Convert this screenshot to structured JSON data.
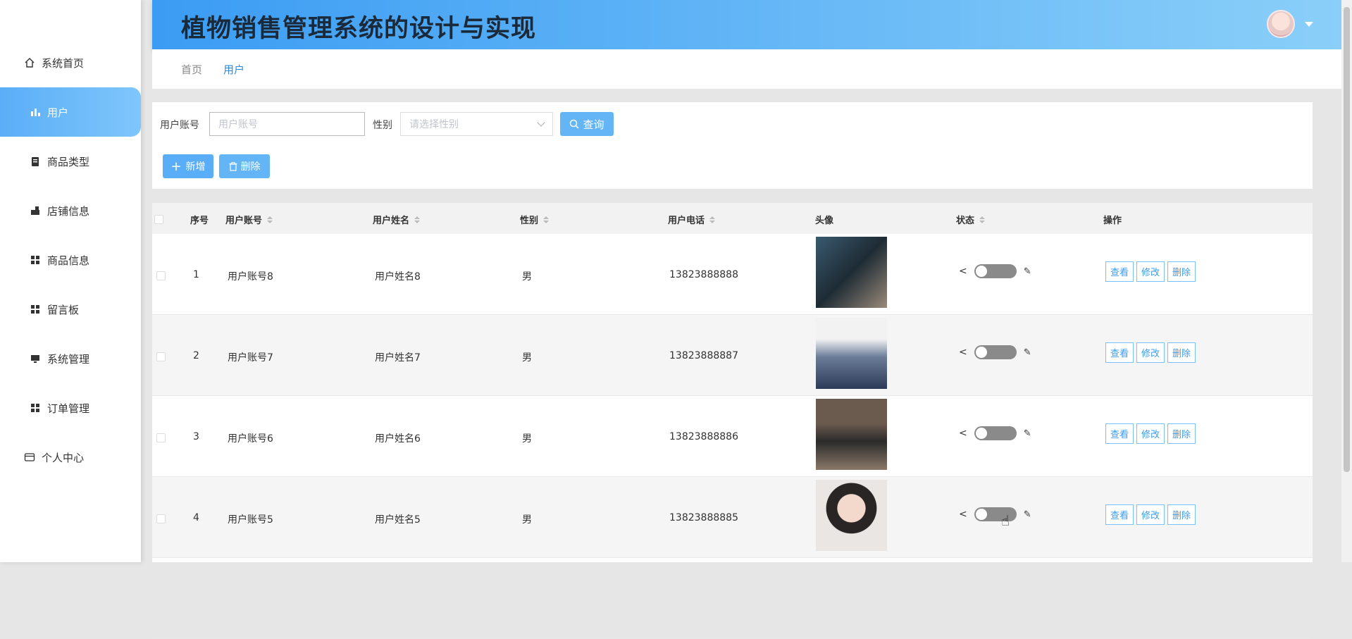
{
  "app": {
    "title": "植物销售管理系统的设计与实现"
  },
  "sidebar": {
    "items": [
      {
        "label": "系统首页",
        "icon": "home-icon"
      },
      {
        "label": "用户",
        "icon": "bar-chart-icon",
        "active": true
      },
      {
        "label": "商品类型",
        "icon": "clipboard-icon"
      },
      {
        "label": "店铺信息",
        "icon": "store-icon"
      },
      {
        "label": "商品信息",
        "icon": "grid-icon"
      },
      {
        "label": "留言板",
        "icon": "grid-icon"
      },
      {
        "label": "系统管理",
        "icon": "monitor-icon"
      },
      {
        "label": "订单管理",
        "icon": "grid-icon"
      },
      {
        "label": "个人中心",
        "icon": "card-icon"
      }
    ]
  },
  "breadcrumb": {
    "home": "首页",
    "current": "用户"
  },
  "search": {
    "account_label": "用户账号",
    "account_placeholder": "用户账号",
    "gender_label": "性别",
    "gender_placeholder": "请选择性别",
    "search_button": "查询",
    "add_button": "新增",
    "delete_button": "删除"
  },
  "table": {
    "headers": {
      "index": "序号",
      "account": "用户账号",
      "name": "用户姓名",
      "gender": "性别",
      "phone": "用户电话",
      "avatar": "头像",
      "status": "状态",
      "actions": "操作"
    },
    "rows": [
      {
        "index": "1",
        "account": "用户账号8",
        "name": "用户姓名8",
        "gender": "男",
        "phone": "13823888888"
      },
      {
        "index": "2",
        "account": "用户账号7",
        "name": "用户姓名7",
        "gender": "男",
        "phone": "13823888887"
      },
      {
        "index": "3",
        "account": "用户账号6",
        "name": "用户姓名6",
        "gender": "男",
        "phone": "13823888886"
      },
      {
        "index": "4",
        "account": "用户账号5",
        "name": "用户姓名5",
        "gender": "男",
        "phone": "13823888885"
      }
    ],
    "row_actions": {
      "view": "查看",
      "edit": "修改",
      "delete": "删除"
    }
  },
  "colors": {
    "accent": "#5aaef7",
    "header_gradient_start": "#3b9cf3",
    "header_gradient_end": "#8acff9"
  }
}
